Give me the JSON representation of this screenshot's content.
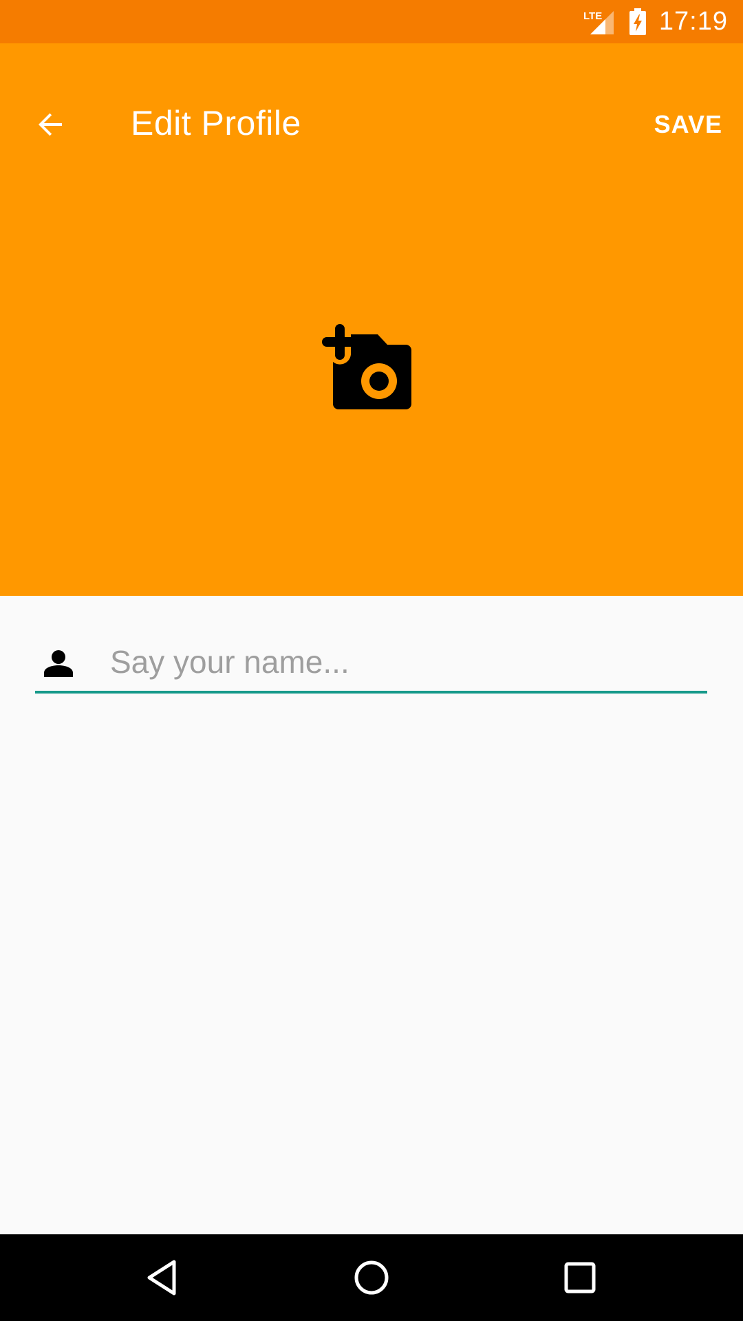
{
  "status_bar": {
    "network": "LTE",
    "time": "17:19",
    "icons": [
      "lte-signal-icon",
      "battery-charging-icon"
    ]
  },
  "app_bar": {
    "back_icon": "arrow-back-icon",
    "title": "Edit Profile",
    "save_label": "SAVE"
  },
  "photo": {
    "icon": "add-a-photo-icon"
  },
  "name_field": {
    "icon": "person-icon",
    "value": "",
    "placeholder": "Say your name..."
  },
  "nav_bar": {
    "icons": [
      "back-triangle-icon",
      "home-circle-icon",
      "recents-square-icon"
    ]
  },
  "colors": {
    "status_bar": "#f57c00",
    "header": "#ff9800",
    "background": "#fafafa",
    "accent": "#16998a",
    "nav_bar": "#000000"
  }
}
